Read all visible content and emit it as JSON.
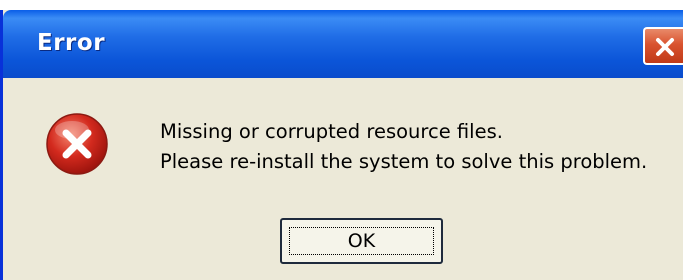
{
  "window": {
    "title": "Error",
    "close_icon": "close-icon"
  },
  "dialog": {
    "icon": "error-icon",
    "message_line1": "Missing or corrupted resource files.",
    "message_line2": "Please re-install the system to solve this problem.",
    "ok_label": "OK"
  },
  "colors": {
    "titlebar": "#0b55d8",
    "dialog_background": "#ece9d8",
    "close_button": "#d9532f",
    "error_icon": "#d32a1e"
  }
}
